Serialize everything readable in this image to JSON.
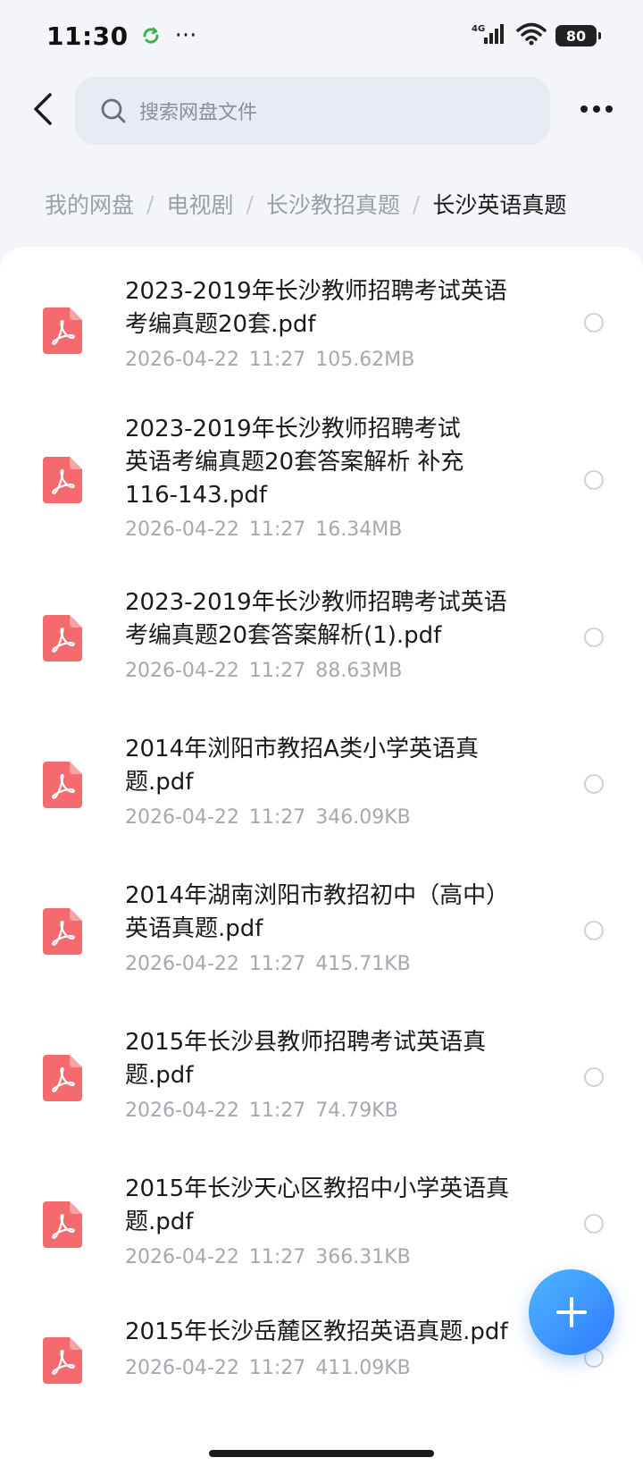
{
  "status": {
    "time": "11:30",
    "network": "4G",
    "battery": "80"
  },
  "search": {
    "placeholder": "搜索网盘文件"
  },
  "breadcrumb": {
    "items": [
      "我的网盘",
      "电视剧",
      "长沙教招真题"
    ],
    "separator": "/",
    "current": "长沙英语真题"
  },
  "files": [
    {
      "name": "2023-2019年长沙教师招聘考试英语\n考编真题20套.pdf",
      "date": "2026-04-22",
      "time": "11:27",
      "size": "105.62MB"
    },
    {
      "name": "2023-2019年长沙教师招聘考试\n英语考编真题20套答案解析 补充\n116-143.pdf",
      "date": "2026-04-22",
      "time": "11:27",
      "size": "16.34MB"
    },
    {
      "name": "2023-2019年长沙教师招聘考试英语\n考编真题20套答案解析(1).pdf",
      "date": "2026-04-22",
      "time": "11:27",
      "size": "88.63MB"
    },
    {
      "name": "2014年浏阳市教招A类小学英语真\n题.pdf",
      "date": "2026-04-22",
      "time": "11:27",
      "size": "346.09KB"
    },
    {
      "name": "2014年湖南浏阳市教招初中（高中）\n英语真题.pdf",
      "date": "2026-04-22",
      "time": "11:27",
      "size": "415.71KB"
    },
    {
      "name": "2015年长沙县教师招聘考试英语真\n题.pdf",
      "date": "2026-04-22",
      "time": "11:27",
      "size": "74.79KB"
    },
    {
      "name": "2015年长沙天心区教招中小学英语真\n题.pdf",
      "date": "2026-04-22",
      "time": "11:27",
      "size": "366.31KB"
    },
    {
      "name": "2015年长沙岳麓区教招英语真题.pdf",
      "date": "2026-04-22",
      "time": "11:27",
      "size": "411.09KB"
    }
  ],
  "icons": {
    "file": "pdf-file-icon",
    "fab": "plus-icon",
    "back": "chevron-left-icon",
    "more": "more-icon",
    "search": "search-icon"
  },
  "colors": {
    "pdf": "#f46a6f",
    "fab_start": "#4fb6ff",
    "fab_end": "#2f7bff",
    "background": "#f3f5f9"
  }
}
